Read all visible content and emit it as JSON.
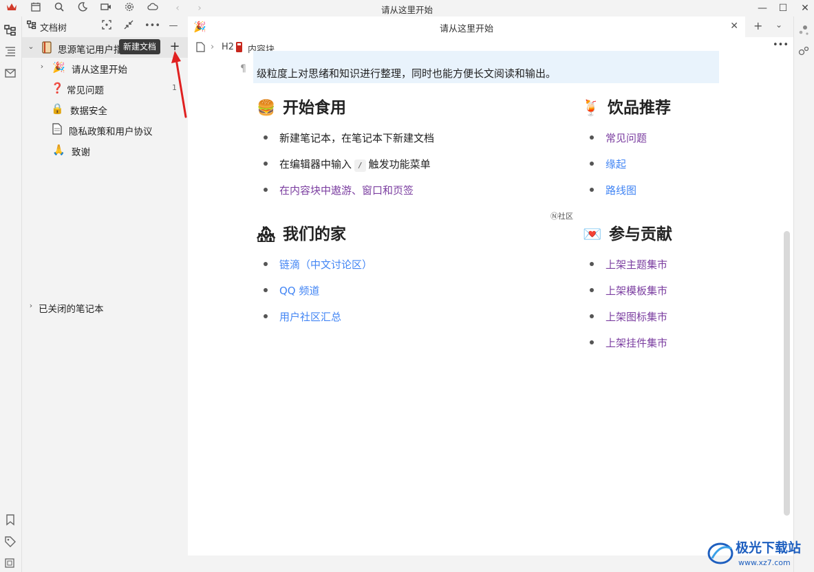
{
  "window": {
    "title": "请从这里开始"
  },
  "filetree": {
    "title": "文档树",
    "notebook": {
      "name": "思源笔记用户指南",
      "icon": "notebook-icon"
    },
    "tooltip": "新建文档",
    "items": [
      {
        "label": "请从这里开始",
        "icon": "party-popper-icon",
        "emoji": "🎉",
        "expandable": true
      },
      {
        "label": "常见问题",
        "icon": "question-icon",
        "emoji": "❓",
        "count": "1"
      },
      {
        "label": "数据安全",
        "icon": "lock-icon",
        "emoji": "🔒"
      },
      {
        "label": "隐私政策和用户协议",
        "icon": "document-icon",
        "emoji": "📄"
      },
      {
        "label": "致谢",
        "icon": "folded-hands-icon",
        "emoji": "🙏"
      }
    ],
    "closed_notebooks": "已关闭的笔记本"
  },
  "editor": {
    "tab_title": "请从这里开始",
    "breadcrumb": {
      "heading_level": "H2",
      "block_label": "内容块"
    },
    "intro_line2": "级粒度上对思绪和知识进行整理，同时也能方便长文阅读和输出。",
    "sections": {
      "start": {
        "title": "开始食用",
        "emoji": "🍔",
        "items": [
          {
            "parts": [
              "新建笔记本，在笔记本下新建文档"
            ]
          },
          {
            "before": "在编辑器中输入",
            "kbd": "/",
            "after": "触发功能菜单"
          },
          {
            "link": "在内容块中遨游、窗口和页签"
          }
        ]
      },
      "drinks": {
        "title": "饮品推荐",
        "emoji": "🍹",
        "items": [
          "常见问题",
          "缘起",
          "路线图"
        ]
      },
      "home": {
        "title": "我们的家",
        "emoji": "🏘",
        "items": [
          "链滴（中文讨论区）",
          "QQ 频道",
          "用户社区汇总"
        ]
      },
      "contribute": {
        "title": "参与贡献",
        "emoji": "💌",
        "items": [
          "上架主题集市",
          "上架模板集市",
          "上架图标集市",
          "上架挂件集市"
        ]
      }
    },
    "community_badge": "Ⓝ社区"
  },
  "watermark": {
    "cn": "极光下载站",
    "url": "www.xz7.com"
  },
  "colors": {
    "link_blue": "#4285f4",
    "link_purple": "#7b3ea0",
    "highlight": "#e9f3fc",
    "tooltip_bg": "#3a3a3a",
    "arrow": "#e02020"
  }
}
